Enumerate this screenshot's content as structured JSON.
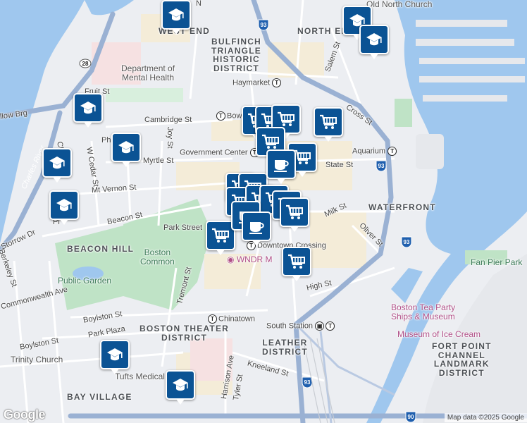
{
  "map": {
    "districts": {
      "west_end": "WEST END",
      "north_end": "NORTH END",
      "bulfinch": "BULFINCH\nTRIANGLE\nHISTORIC\nDISTRICT",
      "waterfront": "WATERFRONT",
      "beacon_hill": "BEACON HILL",
      "boston_theater": "BOSTON THEATER\nDISTRICT",
      "leather": "LEATHER\nDISTRICT",
      "fort_point": "FORT POINT\nCHANNEL\nLANDMARK\nDISTRICT",
      "bay_village": "BAY VILLAGE"
    },
    "streets": {
      "cambridge_st": "Cambridge St",
      "myrtle_st": "Myrtle St",
      "mt_vernon_st": "Mt Vernon St",
      "beacon_st": "Beacon St",
      "charles_st": "Charles St",
      "w_cedar_st": "W Cedar St",
      "joy_st": "Joy St",
      "fruit_st": "Fruit St",
      "state_st": "State St",
      "milk_st": "Milk St",
      "oliver_st": "Oliver St",
      "high_st": "High St",
      "cross_st": "Cross St",
      "salem_st": "Salem St",
      "boylston_st_a": "Boylston St",
      "boylston_st_b": "Boylston St",
      "park_plaza": "Park Plaza",
      "tremont_st": "Tremont St",
      "kneeland_st": "Kneeland St",
      "harrison_ave": "Harrison Ave",
      "tyler_st": "Tyler St",
      "berkeley_st": "Berkeley St",
      "commonwealth_ave": "Commonwealth Ave",
      "storrow_dr": "Storrow Dr",
      "llow_brg": "llow Brg",
      "ph_st": "Ph",
      "pl": "Pl"
    },
    "places": {
      "government_center": "Government Center",
      "haymarket": "Haymarket",
      "bowdoin": "Bow",
      "aquarium": "Aquarium",
      "park_street": "Park Street",
      "downtown_crossing": "Downtown Crossing",
      "chinatown": "Chinatown",
      "south_station": "South Station",
      "north_station": "N",
      "ch": "ch"
    },
    "pois": {
      "dept_mental_health": "Department of\nMental Health",
      "boston_common": "Boston\nCommon",
      "public_garden": "Public Garden",
      "trinity_church": "Trinity Church",
      "tufts_medical": "Tufts Medical Ce",
      "wndr_museum": "WNDR M",
      "tea_party": "Boston Tea Party\nShips & Museum",
      "ice_cream": "Museum of Ice Cream",
      "fan_pier": "Fan Pier Park",
      "north_church": "Old North Church",
      "charles_river": "Charles River"
    },
    "highways": {
      "i93_n": "93",
      "i93_c": "93",
      "i93_s": "93",
      "i90": "90",
      "rt28": "28"
    }
  },
  "branding": {
    "logo": "Google",
    "attribution": "Map data ©2025 Google"
  },
  "colors": {
    "marker": "#0b5394",
    "water": "#9fc7ee",
    "park": "#bfe3c6",
    "highway": "#9ab1d3"
  },
  "markers": [
    {
      "type": "school-icon"
    },
    {
      "type": "school-icon"
    },
    {
      "type": "school-icon"
    },
    {
      "type": "school-icon"
    },
    {
      "type": "school-icon"
    },
    {
      "type": "school-icon"
    },
    {
      "type": "school-icon"
    },
    {
      "type": "school-icon"
    },
    {
      "type": "school-icon"
    },
    {
      "type": "cart-icon"
    },
    {
      "type": "cart-icon"
    },
    {
      "type": "cart-icon"
    },
    {
      "type": "cart-icon"
    },
    {
      "type": "cart-icon"
    },
    {
      "type": "cart-icon"
    },
    {
      "type": "cart-icon"
    },
    {
      "type": "cart-icon"
    },
    {
      "type": "cart-icon"
    },
    {
      "type": "cart-icon"
    },
    {
      "type": "cart-icon"
    },
    {
      "type": "cart-icon"
    },
    {
      "type": "cart-icon"
    },
    {
      "type": "cart-icon"
    },
    {
      "type": "cart-icon"
    },
    {
      "type": "cafe-icon"
    },
    {
      "type": "cafe-icon"
    },
    {
      "type": "cafe-icon"
    }
  ]
}
